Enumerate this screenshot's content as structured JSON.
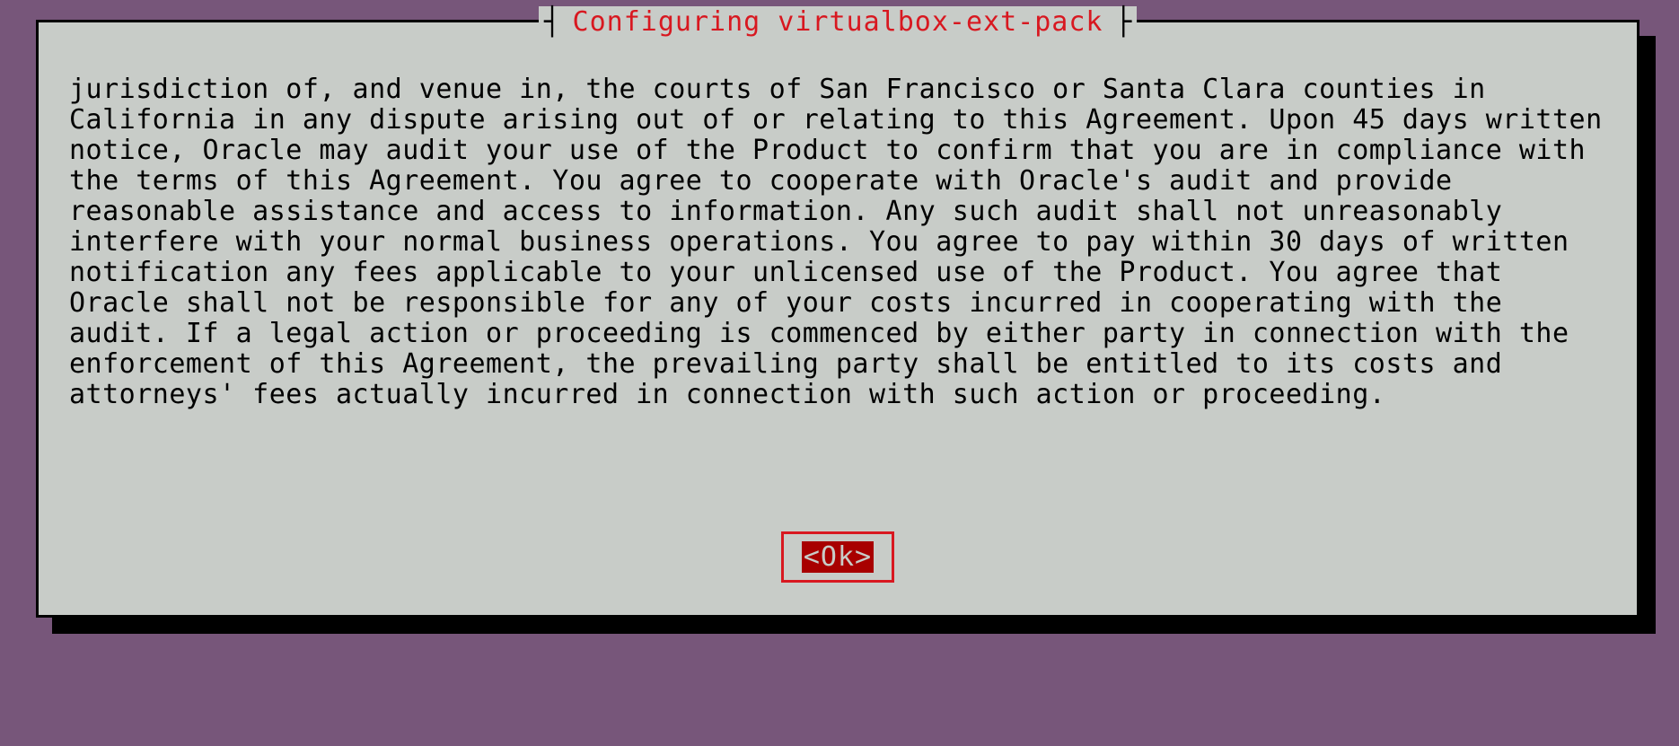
{
  "dialog": {
    "title": "Configuring virtualbox-ext-pack",
    "body": "jurisdiction of, and venue in, the courts of San Francisco or Santa Clara counties in California in any dispute arising out of or relating to this Agreement. Upon 45 days written notice, Oracle may audit your use of the Product to confirm that you are in compliance with the terms of this Agreement. You agree to cooperate with Oracle's audit and provide reasonable assistance and access to information. Any such audit shall not unreasonably interfere with your normal business operations. You agree to pay within 30 days of written notification any fees applicable to your unlicensed use of the Product. You agree that Oracle shall not be responsible for any of your costs incurred in cooperating with the audit. If a legal action or proceeding is commenced by either party in connection with the enforcement of this Agreement, the prevailing party shall be entitled to its costs and attorneys' fees actually incurred in connection with such action or proceeding.",
    "ok_label": "<Ok>"
  }
}
